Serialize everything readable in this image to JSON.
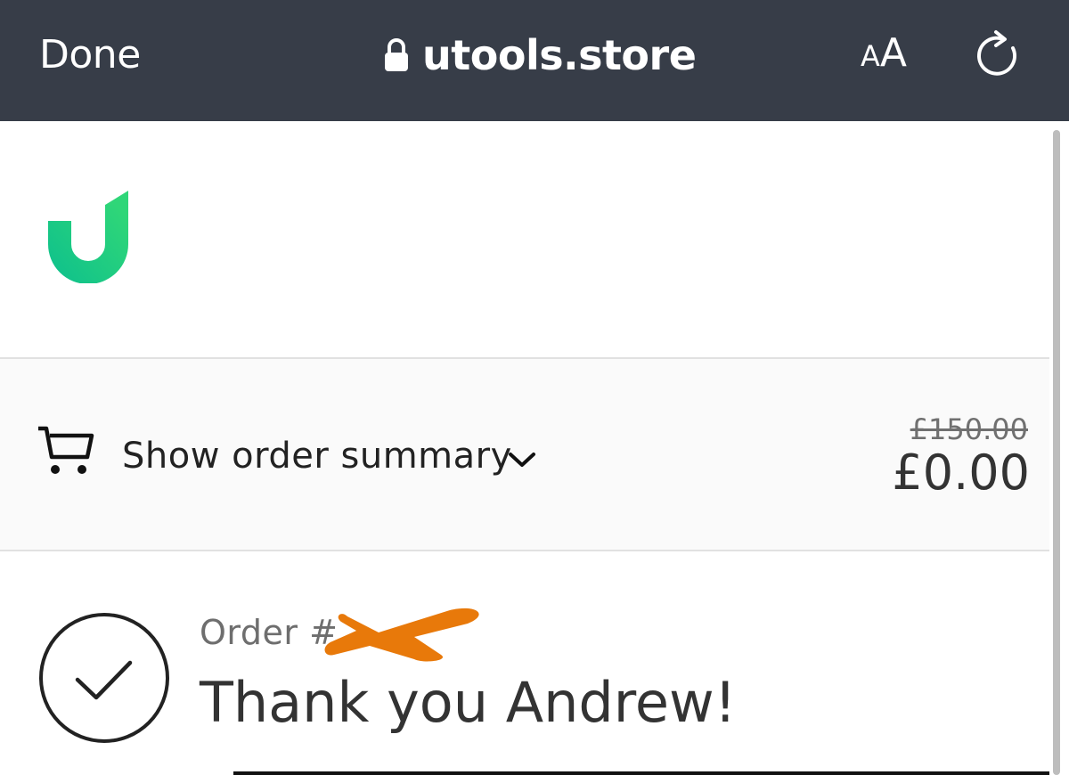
{
  "browser": {
    "done_label": "Done",
    "url": "utools.store",
    "text_size_small": "A",
    "text_size_large": "A"
  },
  "colors": {
    "toolbar_bg": "#373d48",
    "brand_green": "#1fcf8f",
    "redaction": "#e8790a"
  },
  "summary": {
    "toggle_label": "Show order summary",
    "original_price": "£150.00",
    "total_price": "£0.00"
  },
  "confirmation": {
    "order_prefix": "Order #",
    "heading": "Thank you Andrew!"
  },
  "icons": [
    "lock-icon",
    "reload-icon",
    "brand-logo",
    "cart-icon",
    "chevron-down-icon",
    "checkmark-circle-icon"
  ]
}
